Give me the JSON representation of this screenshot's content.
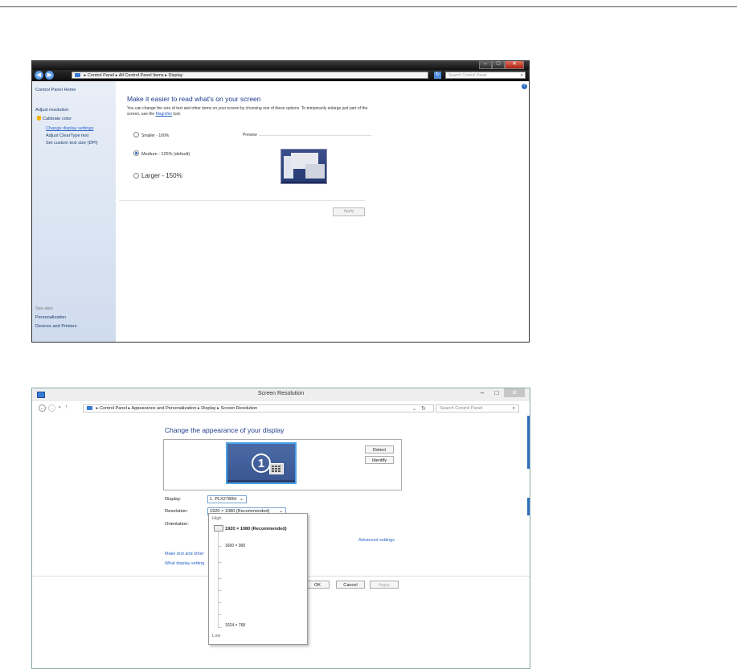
{
  "window1": {
    "address_path": [
      "Control Panel",
      "All Control Panel Items",
      "Display"
    ],
    "search_placeholder": "Search Control Panel",
    "sidebar": {
      "home": "Control Panel Home",
      "items": [
        "Adjust resolution",
        "Calibrate color",
        "Change display settings",
        "Adjust ClearType text",
        "Set custom text size (DPI)"
      ],
      "see_also": "See also",
      "see_also_items": [
        "Personalization",
        "Devices and Printers"
      ]
    },
    "heading": "Make it easier to read what's on your screen",
    "description_1": "You can change the size of text and other items on your screen by choosing one of these options. To temporarily enlarge just part of the screen, use the",
    "magnifier_link": "Magnifier",
    "description_2": "tool.",
    "options": [
      {
        "label": "Smaller - 100%",
        "selected": false
      },
      {
        "label": "Medium - 125% (default)",
        "selected": true
      },
      {
        "label": "Larger - 150%",
        "selected": false
      }
    ],
    "preview_label": "Preview",
    "apply_label": "Apply"
  },
  "window2": {
    "title": "Screen Resolution",
    "address_path": [
      "Control Panel",
      "Appearance and Personalization",
      "Display",
      "Screen Resolution"
    ],
    "search_placeholder": "Search Control Panel",
    "heading": "Change the appearance of your display",
    "monitor_number": "1",
    "detect_label": "Detect",
    "identify_label": "Identify",
    "display_label": "Display:",
    "display_value": "1. PLX2780H",
    "resolution_label": "Resolution:",
    "resolution_value": "1920 × 1080 (Recommended)",
    "orientation_label": "Orientation:",
    "advanced_link": "Advanced settings",
    "link1": "Make text and other",
    "link2": "What display setting",
    "ok_label": "OK",
    "cancel_label": "Cancel",
    "apply_label": "Apply",
    "dropdown": {
      "high_label": "High",
      "low_label": "Low",
      "options": [
        "1920 × 1080 (Recommended)",
        "1600 × 900",
        "1024 × 768"
      ],
      "selected_index": 0
    }
  },
  "icons": {
    "back": "back-arrow-icon",
    "forward": "forward-arrow-icon",
    "up": "up-arrow-icon",
    "refresh": "refresh-icon",
    "search": "search-icon",
    "help": "help-icon"
  },
  "colors": {
    "heading_blue": "#1e3c8c",
    "link_blue": "#2a64c8",
    "desktop_blue": "#3a5591",
    "monitor_border": "#4aa3e8"
  }
}
